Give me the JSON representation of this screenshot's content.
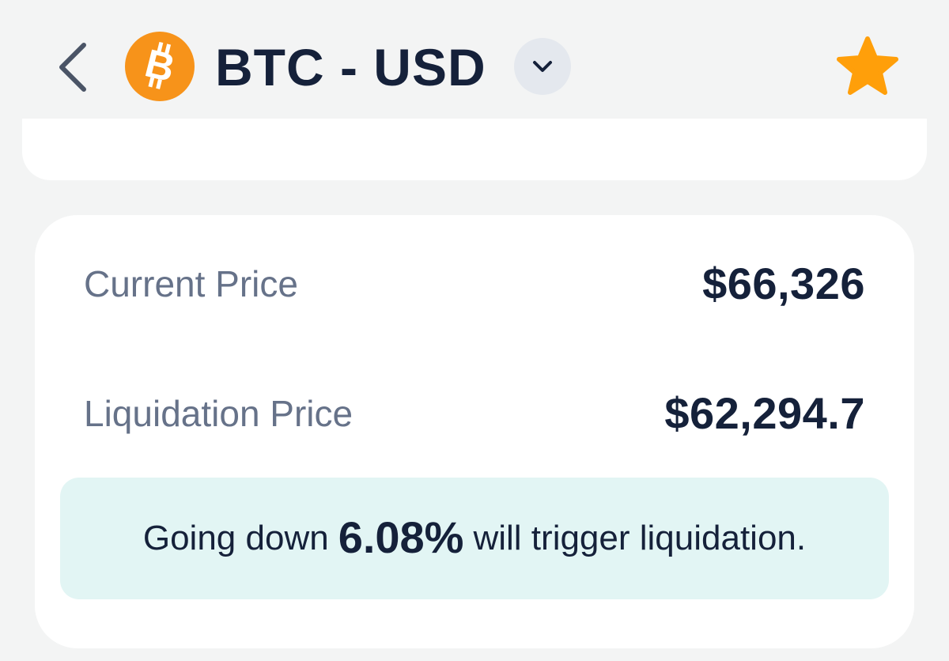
{
  "header": {
    "back_icon": "chevron-left-icon",
    "coin_icon": "bitcoin-icon",
    "coin_color": "#f7931a",
    "pair": "BTC - USD",
    "dropdown_icon": "chevron-down-icon",
    "favorite_icon": "star-icon",
    "favorite_color": "#ff9f0a",
    "favorited": true
  },
  "prices": {
    "current_label": "Current Price",
    "current_value": "$66,326",
    "liquidation_label": "Liquidation Price",
    "liquidation_value": "$62,294.7"
  },
  "warning": {
    "prefix": "Going down",
    "percent": "6.08%",
    "suffix": "will trigger liquidation.",
    "background": "#e2f5f4"
  }
}
